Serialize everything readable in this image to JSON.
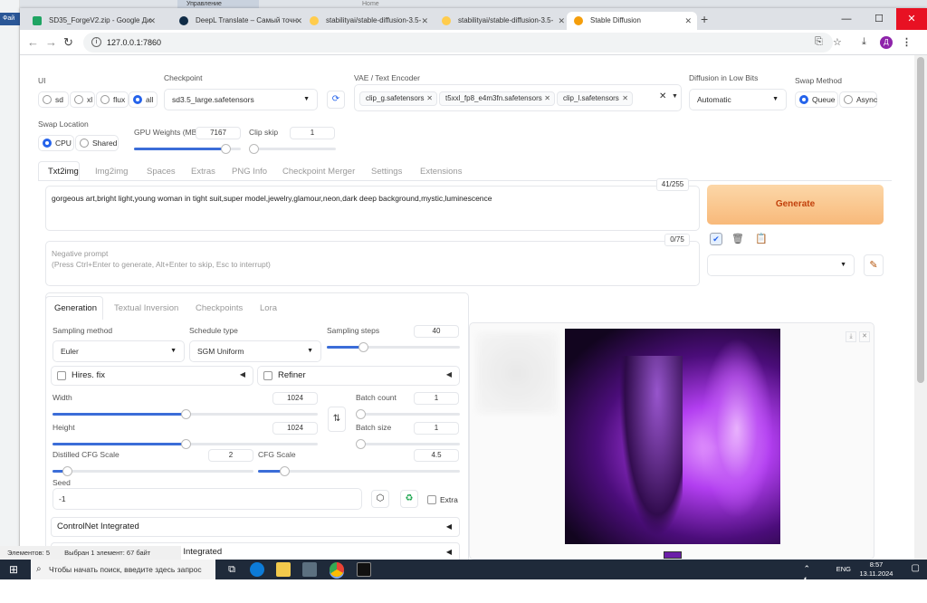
{
  "background": {
    "app_tab": "Управление",
    "app_tab2": "Home",
    "left_file": "Фай",
    "status_left": "Элементов: 5",
    "status_right": "Выбран 1 элемент: 67 байт"
  },
  "browser": {
    "tabs": [
      {
        "title": "SD35_ForgeV2.zip - Google Ди",
        "color": "#1fa463"
      },
      {
        "title": "DeepL Translate – Самый точн",
        "color": "#0f2b46"
      },
      {
        "title": "stabilityai/stable-diffusion-3.5-",
        "color": "#ffcc4d"
      },
      {
        "title": "stabilityai/stable-diffusion-3.5-",
        "color": "#ffcc4d"
      },
      {
        "title": "Stable Diffusion",
        "color": "#f59e0b"
      }
    ],
    "url": "127.0.0.1:7860",
    "profile_letter": "Д"
  },
  "settings": {
    "ui_label": "UI",
    "ui_options": [
      "sd",
      "xl",
      "flux",
      "all"
    ],
    "ui_selected": "all",
    "checkpoint_label": "Checkpoint",
    "checkpoint_value": "sd3.5_large.safetensors",
    "vae_label": "VAE / Text Encoder",
    "vae_chips": [
      "clip_g.safetensors",
      "t5xxl_fp8_e4m3fn.safetensors",
      "clip_l.safetensors"
    ],
    "diffusion_label": "Diffusion in Low Bits",
    "diffusion_value": "Automatic",
    "swap_method_label": "Swap Method",
    "swap_method_options": [
      "Queue",
      "Async"
    ],
    "swap_location_label": "Swap Location",
    "swap_location_options": [
      "CPU",
      "Shared"
    ],
    "gpu_weights_label": "GPU Weights (MB)",
    "gpu_weights_value": "7167",
    "gpu_weights_fraction": 0.86,
    "clip_skip_label": "Clip skip",
    "clip_skip_value": "1",
    "clip_skip_fraction": 0.0
  },
  "main_tabs": [
    "Txt2img",
    "Img2img",
    "Spaces",
    "Extras",
    "PNG Info",
    "Checkpoint Merger",
    "Settings",
    "Extensions"
  ],
  "prompt": {
    "text": "gorgeous art,bright light,young woman in tight suit,super model,jewelry,glamour,neon,dark deep background,mystic,luminescence",
    "counter": "41/255",
    "negative_placeholder": "Negative prompt\n(Press Ctrl+Enter to generate, Alt+Enter to skip, Esc to interrupt)",
    "negative_counter": "0/75"
  },
  "generate_label": "Generate",
  "sub_tabs": [
    "Generation",
    "Textual Inversion",
    "Checkpoints",
    "Lora"
  ],
  "generation": {
    "sampling_method_label": "Sampling method",
    "sampling_method_value": "Euler",
    "schedule_type_label": "Schedule type",
    "schedule_type_value": "SGM Uniform",
    "sampling_steps_label": "Sampling steps",
    "sampling_steps_value": "40",
    "sampling_steps_fraction": 0.27,
    "hires_label": "Hires. fix",
    "refiner_label": "Refiner",
    "width_label": "Width",
    "width_value": "1024",
    "width_fraction": 0.5,
    "height_label": "Height",
    "height_value": "1024",
    "height_fraction": 0.5,
    "batch_count_label": "Batch count",
    "batch_count_value": "1",
    "batch_size_label": "Batch size",
    "batch_size_value": "1",
    "distilled_cfg_label": "Distilled CFG Scale",
    "distilled_cfg_value": "2",
    "distilled_cfg_fraction": 0.07,
    "cfg_label": "CFG Scale",
    "cfg_value": "4.5",
    "cfg_fraction": 0.13,
    "seed_label": "Seed",
    "seed_value": "-1",
    "extra_label": "Extra",
    "controlnet_label": "ControlNet Integrated",
    "dynamic_label": "DynamicThresholding (CFG-Fix) Integrated"
  },
  "taskbar": {
    "search_placeholder": "Чтобы начать поиск, введите здесь запрос",
    "lang": "ENG",
    "time": "8:57",
    "date": "13.11.2024"
  }
}
